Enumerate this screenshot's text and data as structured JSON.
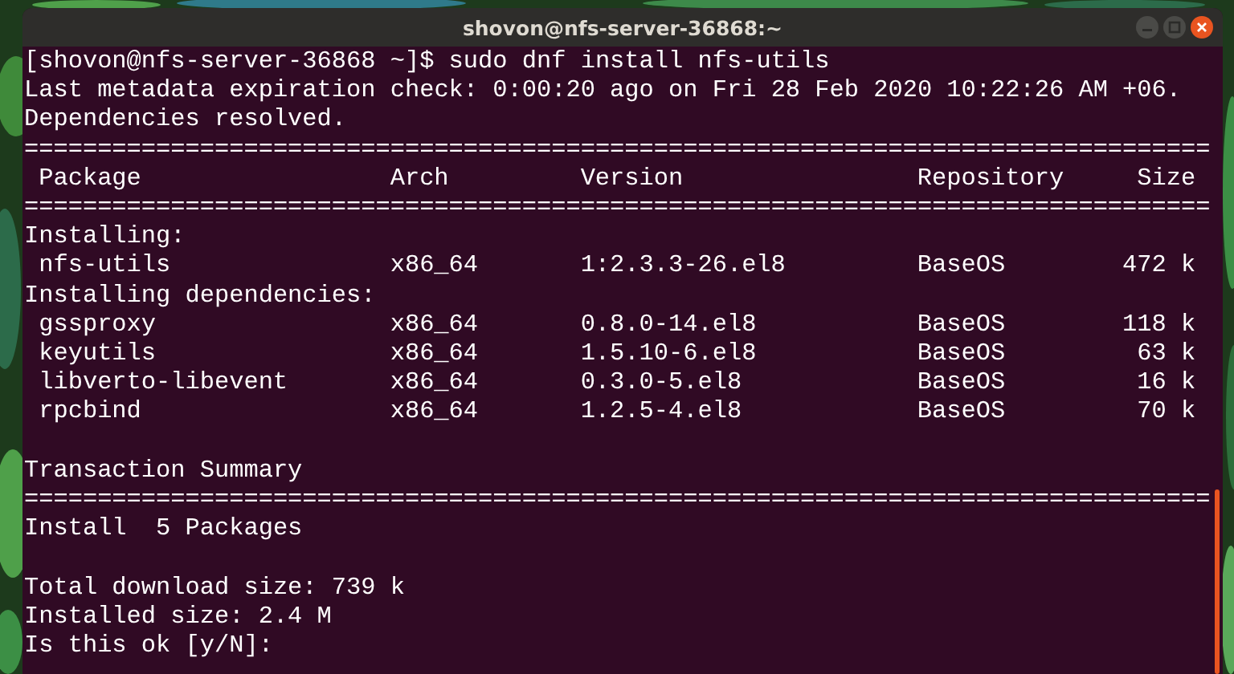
{
  "window": {
    "title": "shovon@nfs-server-36868:~"
  },
  "terminal": {
    "lines": [
      {
        "kind": "text",
        "text": "[shovon@nfs-server-36868 ~]$ sudo dnf install nfs-utils"
      },
      {
        "kind": "text",
        "text": "Last metadata expiration check: 0:00:20 ago on Fri 28 Feb 2020 10:22:26 AM +06."
      },
      {
        "kind": "text",
        "text": "Dependencies resolved."
      },
      {
        "kind": "rule",
        "text": "================================================================================="
      },
      {
        "kind": "header",
        "cells": [
          "Package",
          "Arch",
          "Version",
          "Repository",
          "Size"
        ]
      },
      {
        "kind": "rule",
        "text": "================================================================================="
      },
      {
        "kind": "text",
        "text": "Installing:"
      },
      {
        "kind": "package",
        "cells": [
          "nfs-utils",
          "x86_64",
          "1:2.3.3-26.el8",
          "BaseOS",
          "472 k"
        ]
      },
      {
        "kind": "text",
        "text": "Installing dependencies:"
      },
      {
        "kind": "package",
        "cells": [
          "gssproxy",
          "x86_64",
          "0.8.0-14.el8",
          "BaseOS",
          "118 k"
        ]
      },
      {
        "kind": "package",
        "cells": [
          "keyutils",
          "x86_64",
          "1.5.10-6.el8",
          "BaseOS",
          "63 k"
        ]
      },
      {
        "kind": "package",
        "cells": [
          "libverto-libevent",
          "x86_64",
          "0.3.0-5.el8",
          "BaseOS",
          "16 k"
        ]
      },
      {
        "kind": "package",
        "cells": [
          "rpcbind",
          "x86_64",
          "1.2.5-4.el8",
          "BaseOS",
          "70 k"
        ]
      },
      {
        "kind": "blank"
      },
      {
        "kind": "text",
        "text": "Transaction Summary"
      },
      {
        "kind": "rule",
        "text": "================================================================================="
      },
      {
        "kind": "text",
        "text": "Install  5 Packages"
      },
      {
        "kind": "blank"
      },
      {
        "kind": "text",
        "text": "Total download size: 739 k"
      },
      {
        "kind": "text",
        "text": "Installed size: 2.4 M"
      },
      {
        "kind": "text",
        "text": "Is this ok [y/N]:"
      }
    ]
  }
}
